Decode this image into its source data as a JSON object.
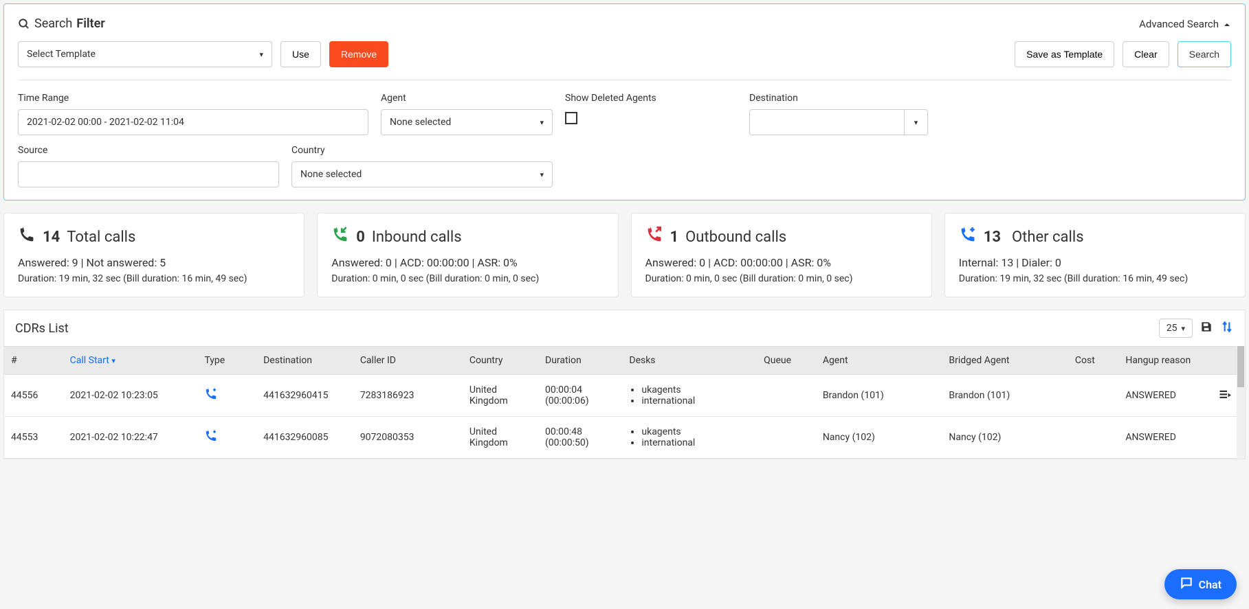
{
  "filter": {
    "title_prefix": "Search",
    "title_bold": "Filter",
    "advanced": "Advanced Search",
    "template_placeholder": "Select Template",
    "use": "Use",
    "remove": "Remove",
    "save_template": "Save as Template",
    "clear": "Clear",
    "search": "Search",
    "fields": {
      "time_range": {
        "label": "Time Range",
        "value": "2021-02-02 00:00 - 2021-02-02 11:04"
      },
      "agent": {
        "label": "Agent",
        "value": "None selected"
      },
      "show_deleted": {
        "label": "Show Deleted Agents",
        "checked": false
      },
      "destination": {
        "label": "Destination",
        "value": ""
      },
      "source": {
        "label": "Source",
        "value": ""
      },
      "country": {
        "label": "Country",
        "value": "None selected"
      }
    }
  },
  "stats": {
    "total": {
      "count": "14",
      "label": "Total calls",
      "line1": "Answered: 9 | Not answered: 5",
      "line2": "Duration: 19 min, 32 sec (Bill duration: 16 min, 49 sec)"
    },
    "inbound": {
      "count": "0",
      "label": "Inbound calls",
      "line1": "Answered: 0 | ACD: 00:00:00 | ASR: 0%",
      "line2": "Duration: 0 min, 0 sec (Bill duration: 0 min, 0 sec)"
    },
    "outbound": {
      "count": "1",
      "label": "Outbound calls",
      "line1": "Answered: 0 | ACD: 00:00:00 | ASR: 0%",
      "line2": "Duration: 0 min, 0 sec (Bill duration: 0 min, 0 sec)"
    },
    "other": {
      "count": "13",
      "label": "Other calls",
      "line1": "Internal: 13 | Dialer: 0",
      "line2": "Duration: 19 min, 32 sec (Bill duration: 16 min, 49 sec)"
    }
  },
  "list": {
    "title": "CDRs List",
    "page_size": "25",
    "columns": [
      "#",
      "Call Start",
      "Type",
      "Destination",
      "Caller ID",
      "Country",
      "Duration",
      "Desks",
      "Queue",
      "Agent",
      "Bridged Agent",
      "Cost",
      "Hangup reason"
    ],
    "rows": [
      {
        "num": "44556",
        "call_start": "2021-02-02 10:23:05",
        "destination": "441632960415",
        "caller_id": "7283186923",
        "country": "United Kingdom",
        "duration": "00:00:04",
        "duration_bill": "(00:00:06)",
        "desks": [
          "ukagents",
          "international"
        ],
        "queue": "",
        "agent": "Brandon (101)",
        "bridged": "Brandon (101)",
        "cost": "",
        "hangup": "ANSWERED"
      },
      {
        "num": "44553",
        "call_start": "2021-02-02 10:22:47",
        "destination": "441632960085",
        "caller_id": "9072080353",
        "country": "United Kingdom",
        "duration": "00:00:48",
        "duration_bill": "(00:00:50)",
        "desks": [
          "ukagents",
          "international"
        ],
        "queue": "",
        "agent": "Nancy (102)",
        "bridged": "Nancy (102)",
        "cost": "",
        "hangup": "ANSWERED"
      }
    ]
  },
  "chat": {
    "label": "Chat"
  }
}
